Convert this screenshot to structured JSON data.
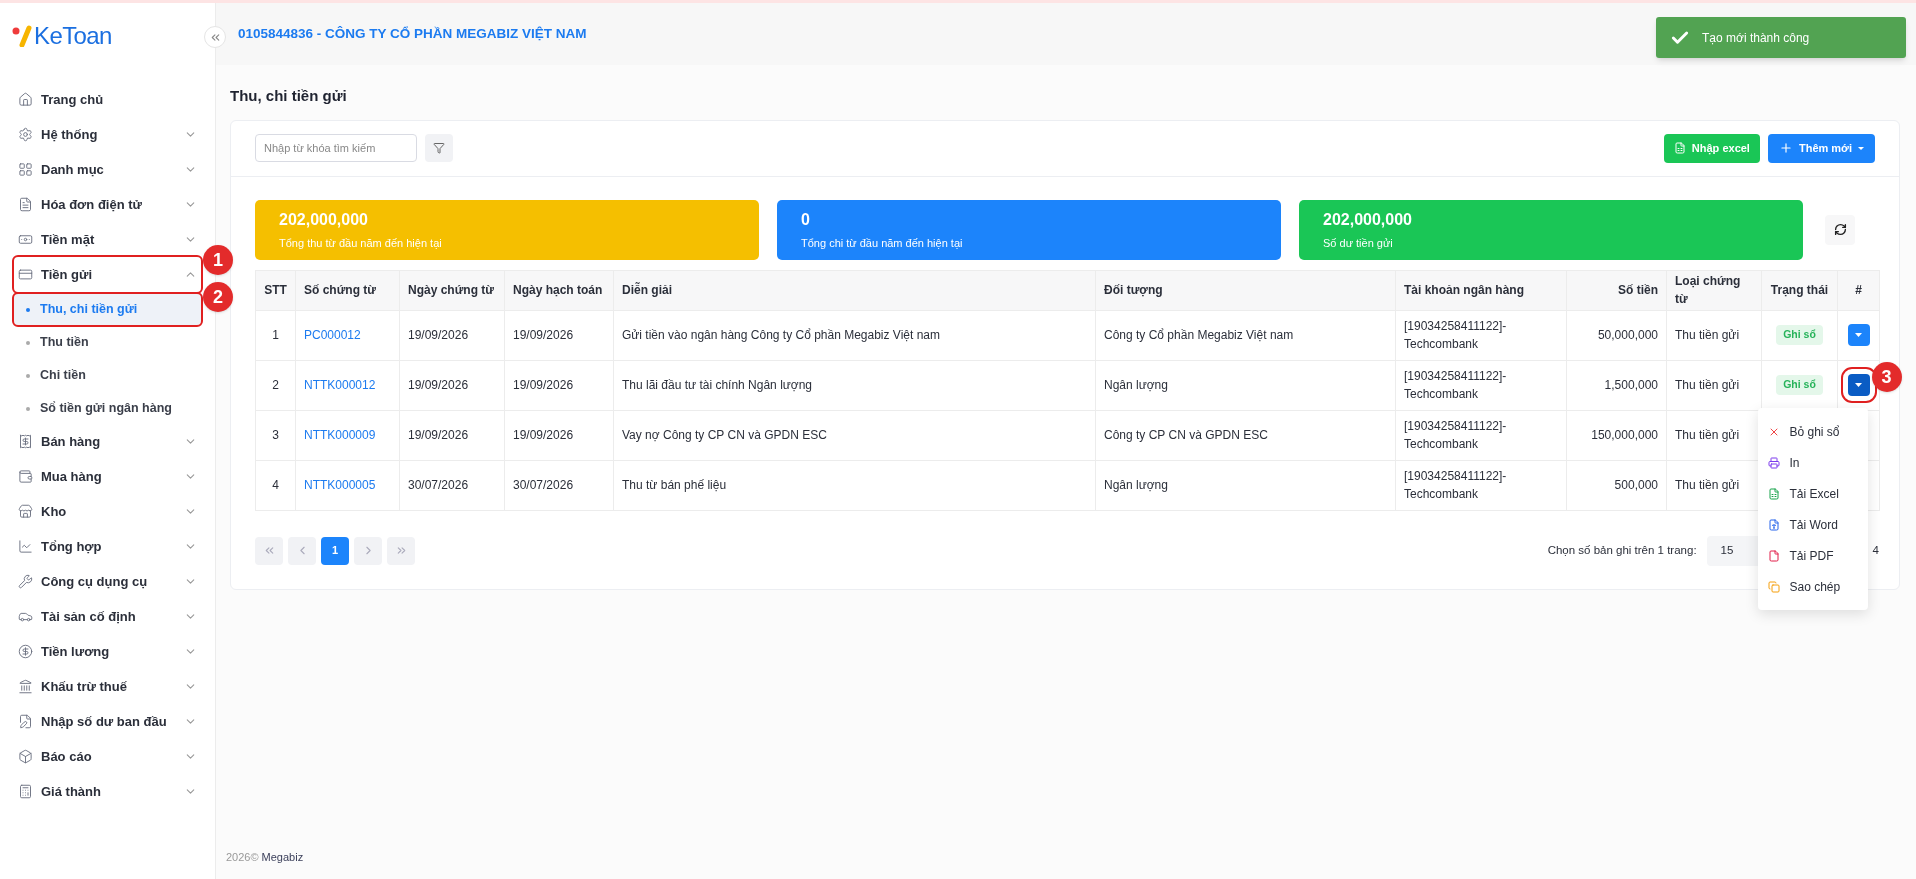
{
  "logo": {
    "text": "KeToan"
  },
  "company": "0105844836 - CÔNG TY CỔ PHẦN MEGABIZ VIỆT NAM",
  "toast": {
    "message": "Tạo mới thành công"
  },
  "sidebar": {
    "items": [
      {
        "label": "Trang chủ",
        "expandable": false
      },
      {
        "label": "Hệ thống",
        "expandable": true,
        "expanded": false
      },
      {
        "label": "Danh mục",
        "expandable": true,
        "expanded": false
      },
      {
        "label": "Hóa đơn điện tử",
        "expandable": true,
        "expanded": false
      },
      {
        "label": "Tiền mặt",
        "expandable": true,
        "expanded": false
      },
      {
        "label": "Tiền gửi",
        "expandable": true,
        "expanded": true,
        "annotation": "1",
        "children": [
          {
            "label": "Thu, chi tiền gửi",
            "selected": true,
            "annotation": "2"
          },
          {
            "label": "Thu tiền",
            "selected": false
          },
          {
            "label": "Chi tiền",
            "selected": false
          },
          {
            "label": "Sổ tiền gửi ngân hàng",
            "selected": false
          }
        ]
      },
      {
        "label": "Bán hàng",
        "expandable": true,
        "expanded": false
      },
      {
        "label": "Mua hàng",
        "expandable": true,
        "expanded": false
      },
      {
        "label": "Kho",
        "expandable": true,
        "expanded": false
      },
      {
        "label": "Tổng hợp",
        "expandable": true,
        "expanded": false
      },
      {
        "label": "Công cụ dụng cụ",
        "expandable": true,
        "expanded": false
      },
      {
        "label": "Tài sản cố định",
        "expandable": true,
        "expanded": false
      },
      {
        "label": "Tiền lương",
        "expandable": true,
        "expanded": false
      },
      {
        "label": "Khấu trừ thuế",
        "expandable": true,
        "expanded": false
      },
      {
        "label": "Nhập số dư ban đầu",
        "expandable": true,
        "expanded": false
      },
      {
        "label": "Báo cáo",
        "expandable": true,
        "expanded": false
      },
      {
        "label": "Giá thành",
        "expandable": true,
        "expanded": false
      }
    ]
  },
  "page_title": "Thu, chi tiền gửi",
  "search": {
    "placeholder": "Nhập từ khóa tìm kiếm"
  },
  "buttons": {
    "import": "Nhập excel",
    "add": "Thêm mới"
  },
  "stats": [
    {
      "value": "202,000,000",
      "label": "Tổng thu từ đầu năm đến hiện tại",
      "color": "#f5bf00"
    },
    {
      "value": "0",
      "label": "Tổng chi từ đầu năm đến hiện tại",
      "color": "#1c84fb"
    },
    {
      "value": "202,000,000",
      "label": "Số dư tiền gửi",
      "color": "#1ac656"
    }
  ],
  "table": {
    "columns": [
      "STT",
      "Số chứng từ",
      "Ngày chứng từ",
      "Ngày hạch toán",
      "Diễn giải",
      "Đối tượng",
      "Tài khoản ngân hàng",
      "Số tiền",
      "Loại chứng từ",
      "Trạng thái",
      "#"
    ],
    "rows": [
      {
        "stt": "1",
        "number": "PC000012",
        "date": "19/09/2026",
        "post_date": "19/09/2026",
        "description": "Gửi tiền vào ngân hàng Công ty Cổ phần Megabiz Việt nam",
        "party": "Công ty Cổ phần Megabiz Việt nam",
        "account": [
          "[19034258411122]-",
          "Techcombank"
        ],
        "amount": "50,000,000",
        "type": "Thu tiền gửi",
        "status": "Ghi sổ",
        "action": true,
        "menu_open": false
      },
      {
        "stt": "2",
        "number": "NTTK000012",
        "date": "19/09/2026",
        "post_date": "19/09/2026",
        "description": "Thu lãi đầu tư tài chính Ngân lượng",
        "party": "Ngân lượng",
        "account": [
          "[19034258411122]-",
          "Techcombank"
        ],
        "amount": "1,500,000",
        "type": "Thu tiền gửi",
        "status": "Ghi sổ",
        "action": true,
        "menu_open": true,
        "annotation": "3"
      },
      {
        "stt": "3",
        "number": "NTTK000009",
        "date": "19/09/2026",
        "post_date": "19/09/2026",
        "description": "Vay nợ Công ty CP CN và GPDN ESC",
        "party": "Công ty CP CN và GPDN ESC",
        "account": [
          "[19034258411122]-",
          "Techcombank"
        ],
        "amount": "150,000,000",
        "type": "Thu tiền gửi",
        "action": false
      },
      {
        "stt": "4",
        "number": "NTTK000005",
        "date": "30/07/2026",
        "post_date": "30/07/2026",
        "description": "Thu từ bán phế liệu",
        "party": "Ngân lượng",
        "account": [
          "[19034258411122]-",
          "Techcombank"
        ],
        "amount": "500,000",
        "type": "Thu tiền gửi",
        "action": false
      }
    ]
  },
  "row_menu": {
    "items": [
      {
        "label": "Bỏ ghi sổ"
      },
      {
        "label": "In"
      },
      {
        "label": "Tải Excel"
      },
      {
        "label": "Tải Word"
      },
      {
        "label": "Tải PDF"
      },
      {
        "label": "Sao chép"
      }
    ]
  },
  "pagination": {
    "pages": [
      {
        "label": "1",
        "selected": true
      }
    ],
    "page_size_label": "Chọn số bản ghi trên 1 trang:",
    "page_size": "15",
    "total": "4"
  },
  "footer": {
    "year": "2026©",
    "brand": "Megabiz"
  }
}
